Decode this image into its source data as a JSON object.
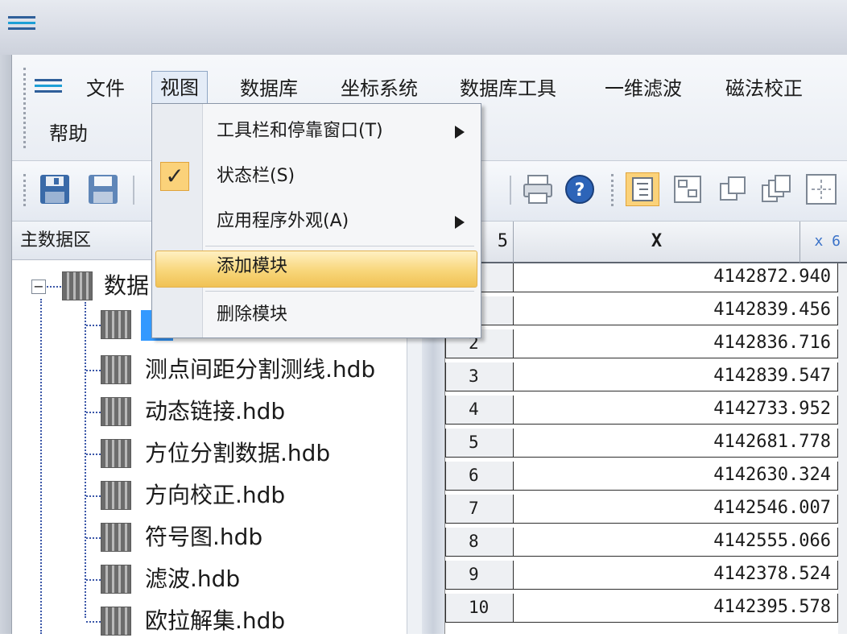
{
  "menubar": {
    "items": [
      "文件",
      "视图",
      "数据库",
      "坐标系统",
      "数据库工具",
      "一维滤波",
      "磁法校正"
    ],
    "help": "帮助"
  },
  "view_menu": {
    "items": [
      {
        "label": "工具栏和停靠窗口(T)",
        "submenu": true
      },
      {
        "label": "状态栏(S)",
        "checked": true,
        "check_mark": "✓"
      },
      {
        "label": "应用程序外观(A)",
        "submenu": true
      },
      {
        "label": "添加模块",
        "highlighted": true
      },
      {
        "label": "删除模块"
      }
    ]
  },
  "left_panel": {
    "title": "主数据区",
    "root_label": "数据",
    "files": [
      "",
      "测点间距分割测线.hdb",
      "动态链接.hdb",
      "方位分割数据.hdb",
      "方向校正.hdb",
      "符号图.hdb",
      "滤波.hdb",
      "欧拉解集.hdb"
    ]
  },
  "grid": {
    "corner_label": "5",
    "x_header": "X",
    "next_header": "x 6",
    "rows": [
      {
        "index": "",
        "x": "4142872.940"
      },
      {
        "index": "",
        "x": "4142839.456"
      },
      {
        "index": "2",
        "x": "4142836.716"
      },
      {
        "index": "3",
        "x": "4142839.547"
      },
      {
        "index": "4",
        "x": "4142733.952"
      },
      {
        "index": "5",
        "x": "4142681.778"
      },
      {
        "index": "6",
        "x": "4142630.324"
      },
      {
        "index": "7",
        "x": "4142546.007"
      },
      {
        "index": "8",
        "x": "4142555.066"
      },
      {
        "index": "9",
        "x": "4142378.524"
      },
      {
        "index": "10",
        "x": "4142395.578"
      }
    ]
  },
  "toolbar": {
    "icons": [
      "save-icon",
      "save-as-icon",
      "print-icon",
      "help-icon",
      "tree-view-icon",
      "split-view-icon",
      "cascade-window-icon",
      "tile-window-icon",
      "crosshair-icon"
    ]
  },
  "colors": {
    "accent_highlight": "#f8d67a",
    "check_background": "#fbd27a",
    "tree_lines": "#3b57a8",
    "selection_blue": "#3399ff"
  }
}
